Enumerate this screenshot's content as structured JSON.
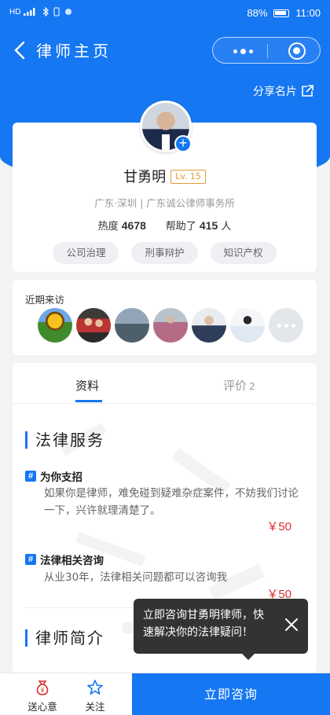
{
  "status": {
    "left_text": "HD",
    "battery": "88%",
    "time": "11:00"
  },
  "header": {
    "title": "律师主页",
    "share_label": "分享名片"
  },
  "profile": {
    "name": "甘勇明",
    "level": "Lv. 15",
    "location": "广东·深圳 | 广东诚公律师事务所",
    "heat_label": "热度",
    "heat_value": "4678",
    "helped_prefix": "帮助了",
    "helped_value": "415",
    "helped_suffix": "人",
    "tags": [
      "公司治理",
      "刑事辩护",
      "知识产权"
    ]
  },
  "visitors": {
    "label": "近期来访"
  },
  "tabs": [
    {
      "label": "资料"
    },
    {
      "label": "评价",
      "count": "2"
    }
  ],
  "legal_services": {
    "title": "法律服务",
    "items": [
      {
        "title": "为你支招",
        "desc": "如果你是律师，难免碰到疑难杂症案件，不妨我们讨论一下，兴许就理清楚了。",
        "price": "￥50"
      },
      {
        "title": "法律相关咨询",
        "desc": "从业30年，法律相关问题都可以咨询我",
        "price": "￥50"
      }
    ]
  },
  "intro": {
    "title": "律师简介"
  },
  "tooltip": {
    "text": "立即咨询甘勇明律师，快速解决你的法律疑问！"
  },
  "bottom": {
    "gift_label": "送心意",
    "follow_label": "关注",
    "consult_label": "立即咨询"
  },
  "colors": {
    "primary": "#1677f2",
    "price": "#d9302c",
    "level": "#e59a3b"
  }
}
